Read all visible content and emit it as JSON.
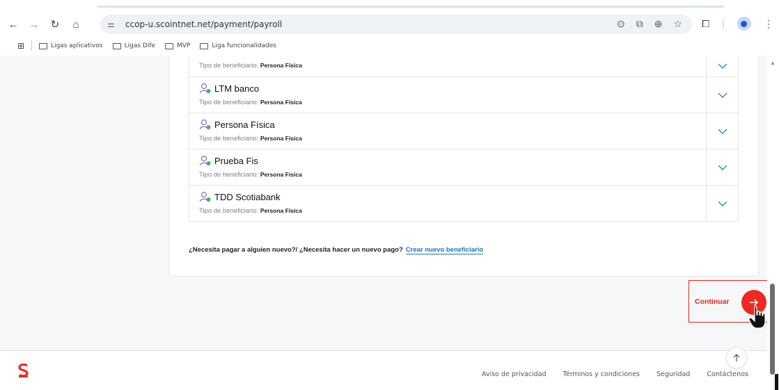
{
  "browser": {
    "url": "ccop-u.scointnet.net/payment/payroll",
    "bookmarks": [
      "Ligas aplicativos",
      "Ligas Dife",
      "MVP",
      "Liga funcionalidades"
    ]
  },
  "beneficiaries": {
    "type_label": "Tipo de beneficiario:",
    "items": [
      {
        "name": "",
        "type_value": "Persona Física"
      },
      {
        "name": "LTM banco",
        "type_value": "Persona Física"
      },
      {
        "name": "Persona Física",
        "type_value": "Persona Física"
      },
      {
        "name": "Prueba Fis",
        "type_value": "Persona Física"
      },
      {
        "name": "TDD Scotiabank",
        "type_value": "Persona Física"
      }
    ]
  },
  "new_payment": {
    "question": "¿Necesita pagar a alguien nuevo?/ ¿Necesita hacer un nuevo pago?",
    "link": "Crear nuevo beneficiario"
  },
  "continue": {
    "label": "Continuar"
  },
  "footer": {
    "links": [
      "Aviso de privacidad",
      "Términos y condiciones",
      "Seguridad",
      "Contáctenos"
    ]
  },
  "colors": {
    "brand_red": "#ec2a1f",
    "link_blue": "#1a73c8",
    "icon_purple": "#8b6bd1",
    "icon_green": "#4cb050"
  }
}
